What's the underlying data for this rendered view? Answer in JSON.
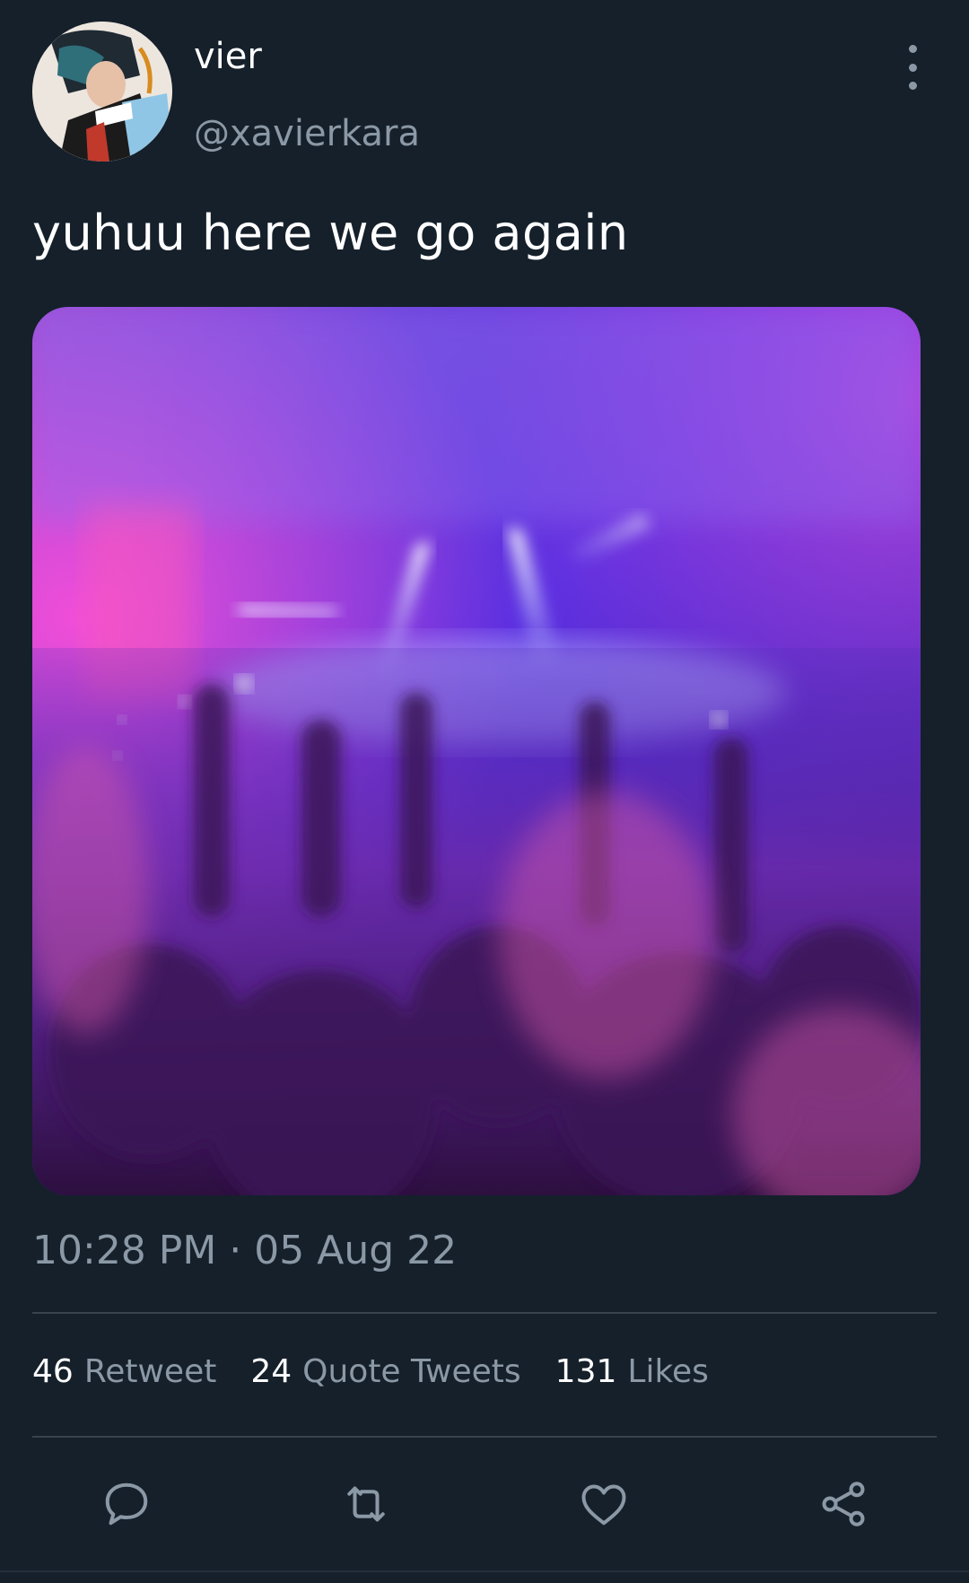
{
  "author": {
    "display_name": "vier",
    "handle": "@xavierkara"
  },
  "tweet": {
    "text": "yuhuu here we go again",
    "time": "10:28 PM",
    "separator": "·",
    "date": "05 Aug 22"
  },
  "stats": [
    {
      "count": "46",
      "label": "Retweet"
    },
    {
      "count": "24",
      "label": "Quote Tweets"
    },
    {
      "count": "131",
      "label": "Likes"
    }
  ],
  "actions": {
    "reply_icon": "reply-icon",
    "retweet_icon": "retweet-icon",
    "like_icon": "heart-icon",
    "share_icon": "share-icon"
  },
  "colors": {
    "background": "#15202b",
    "primary_text": "#ffffff",
    "secondary_text": "#8b98a5",
    "divider": "#38444d"
  }
}
